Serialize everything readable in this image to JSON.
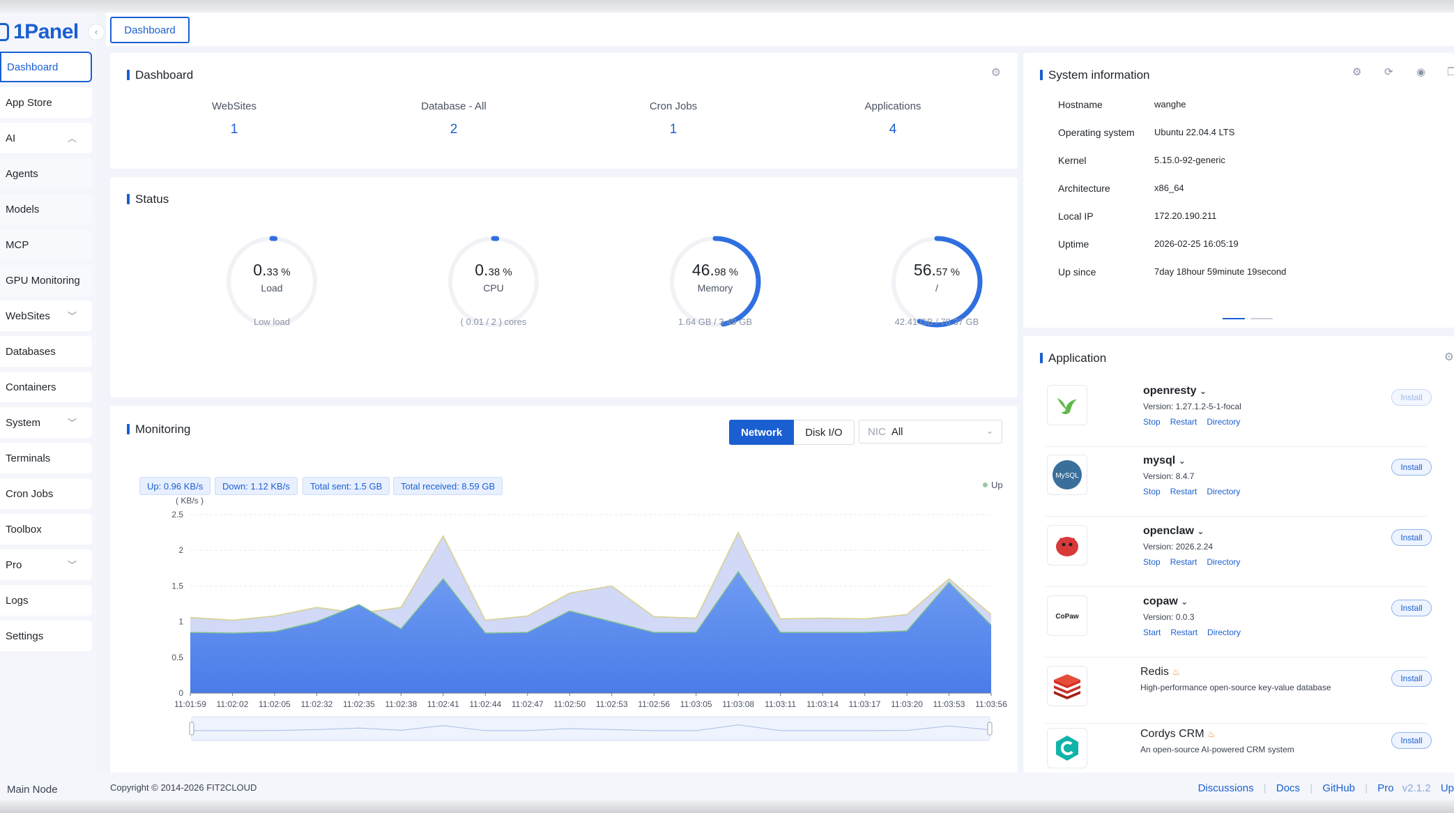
{
  "brand": {
    "name": "1Panel",
    "color": "#1a5fd1"
  },
  "sidebar": {
    "items": [
      {
        "label": "Dashboard",
        "active": true,
        "chevron": ""
      },
      {
        "label": "App Store",
        "chevron": ""
      },
      {
        "label": "AI",
        "chevron": "up"
      },
      {
        "label": "Agents",
        "chevron": ""
      },
      {
        "label": "Models",
        "chevron": ""
      },
      {
        "label": "MCP",
        "chevron": ""
      },
      {
        "label": "GPU Monitoring",
        "chevron": ""
      },
      {
        "label": "WebSites",
        "chevron": "down"
      },
      {
        "label": "Databases",
        "chevron": ""
      },
      {
        "label": "Containers",
        "chevron": ""
      },
      {
        "label": "System",
        "chevron": "down"
      },
      {
        "label": "Terminals",
        "chevron": ""
      },
      {
        "label": "Cron Jobs",
        "chevron": ""
      },
      {
        "label": "Toolbox",
        "chevron": ""
      },
      {
        "label": "Pro",
        "chevron": "down"
      },
      {
        "label": "Logs",
        "chevron": ""
      },
      {
        "label": "Settings",
        "chevron": ""
      }
    ],
    "footer_label": "Main Node"
  },
  "topbar": {
    "tab": "Dashboard"
  },
  "dashboard": {
    "title": "Dashboard",
    "stats": [
      {
        "label": "WebSites",
        "value": "1"
      },
      {
        "label": "Database - All",
        "value": "2"
      },
      {
        "label": "Cron Jobs",
        "value": "1"
      },
      {
        "label": "Applications",
        "value": "4"
      }
    ]
  },
  "status": {
    "title": "Status",
    "gauges": [
      {
        "big": "0.",
        "small": "33 %",
        "label": "Load",
        "sub": "Low load",
        "percent": 0.33
      },
      {
        "big": "0.",
        "small": "38 %",
        "label": "CPU",
        "sub": "( 0.01 / 2 ) cores",
        "percent": 0.38
      },
      {
        "big": "46.",
        "small": "98 %",
        "label": "Memory",
        "sub": "1.64 GB / 3.49 GB",
        "percent": 46.98
      },
      {
        "big": "56.",
        "small": "57 %",
        "label": "/",
        "sub": "42.41 GB / 78.37 GB",
        "percent": 56.57
      }
    ]
  },
  "monitoring": {
    "title": "Monitoring",
    "tabs": [
      "Network",
      "Disk I/O"
    ],
    "nic_label": "NIC",
    "nic_value": "All",
    "tags": [
      "Up: 0.96 KB/s",
      "Down: 1.12 KB/s",
      "Total sent: 1.5 GB",
      "Total received: 8.59 GB"
    ],
    "legend": "Up"
  },
  "chart_data": {
    "type": "area",
    "ylabel": "( KB/s )",
    "ylim": [
      0,
      2.5
    ],
    "yticks": [
      "0",
      "0.5",
      "1",
      "1.5",
      "2",
      "2.5"
    ],
    "x": [
      "11:01:59",
      "11:02:02",
      "11:02:05",
      "11:02:32",
      "11:02:35",
      "11:02:38",
      "11:02:41",
      "11:02:44",
      "11:02:47",
      "11:02:50",
      "11:02:53",
      "11:02:56",
      "11:03:05",
      "11:03:08",
      "11:03:11",
      "11:03:14",
      "11:03:17",
      "11:03:20",
      "11:03:53",
      "11:03:56"
    ],
    "series": [
      {
        "name": "Up",
        "color": "#5b8def",
        "values": [
          0.85,
          0.84,
          0.86,
          1.0,
          1.24,
          0.9,
          1.6,
          0.84,
          0.85,
          1.15,
          1.0,
          0.85,
          0.85,
          1.7,
          0.85,
          0.85,
          0.85,
          0.87,
          1.55,
          0.95
        ]
      },
      {
        "color": "#c9d2f5",
        "values": [
          1.06,
          1.02,
          1.08,
          1.2,
          1.12,
          1.2,
          2.2,
          1.02,
          1.08,
          1.4,
          1.5,
          1.07,
          1.05,
          2.25,
          1.04,
          1.05,
          1.04,
          1.1,
          1.6,
          1.1
        ]
      }
    ],
    "grid": true,
    "legend_position": "top-right"
  },
  "sysinfo": {
    "title": "System information",
    "rows": [
      {
        "key": "Hostname",
        "value": "wanghe"
      },
      {
        "key": "Operating system",
        "value": "Ubuntu 22.04.4 LTS"
      },
      {
        "key": "Kernel",
        "value": "5.15.0-92-generic"
      },
      {
        "key": "Architecture",
        "value": "x86_64"
      },
      {
        "key": "Local IP",
        "value": "172.20.190.211"
      },
      {
        "key": "Uptime",
        "value": "2026-02-25 16:05:19"
      },
      {
        "key": "Up since",
        "value": "7day 18hour 59minute 19second"
      }
    ]
  },
  "applications": {
    "title": "Application",
    "items": [
      {
        "name": "openresty",
        "version": "Version: 1.27.1.2-5-1-focal",
        "links": [
          "Stop",
          "Restart",
          "Directory"
        ],
        "button": "Install",
        "icon": "hummingbird-icon"
      },
      {
        "name": "mysql",
        "version": "Version: 8.4.7",
        "links": [
          "Stop",
          "Restart",
          "Directory"
        ],
        "button": "Install",
        "icon": "mysql-icon",
        "icon_text": "MySQL"
      },
      {
        "name": "openclaw",
        "version": "Version: 2026.2.24",
        "links": [
          "Stop",
          "Restart",
          "Directory"
        ],
        "button": "Install",
        "icon": "openclaw-icon"
      },
      {
        "name": "copaw",
        "version": "Version: 0.0.3",
        "links": [
          "Start",
          "Restart",
          "Directory"
        ],
        "button": "Install",
        "icon": "copaw-icon",
        "icon_text": "CoPaw"
      },
      {
        "name": "Redis",
        "desc": "High-performance open-source key-value database",
        "button": "Install",
        "icon": "redis-icon"
      },
      {
        "name": "Cordys CRM",
        "desc": "An open-source AI-powered CRM system",
        "button": "Install",
        "icon": "cordys-icon"
      }
    ]
  },
  "footer": {
    "copyright": "Copyright © 2014-2026 FIT2CLOUD",
    "links": [
      "Discussions",
      "Docs",
      "GitHub",
      "Pro"
    ],
    "version": "v2.1.2",
    "update": "Up"
  }
}
